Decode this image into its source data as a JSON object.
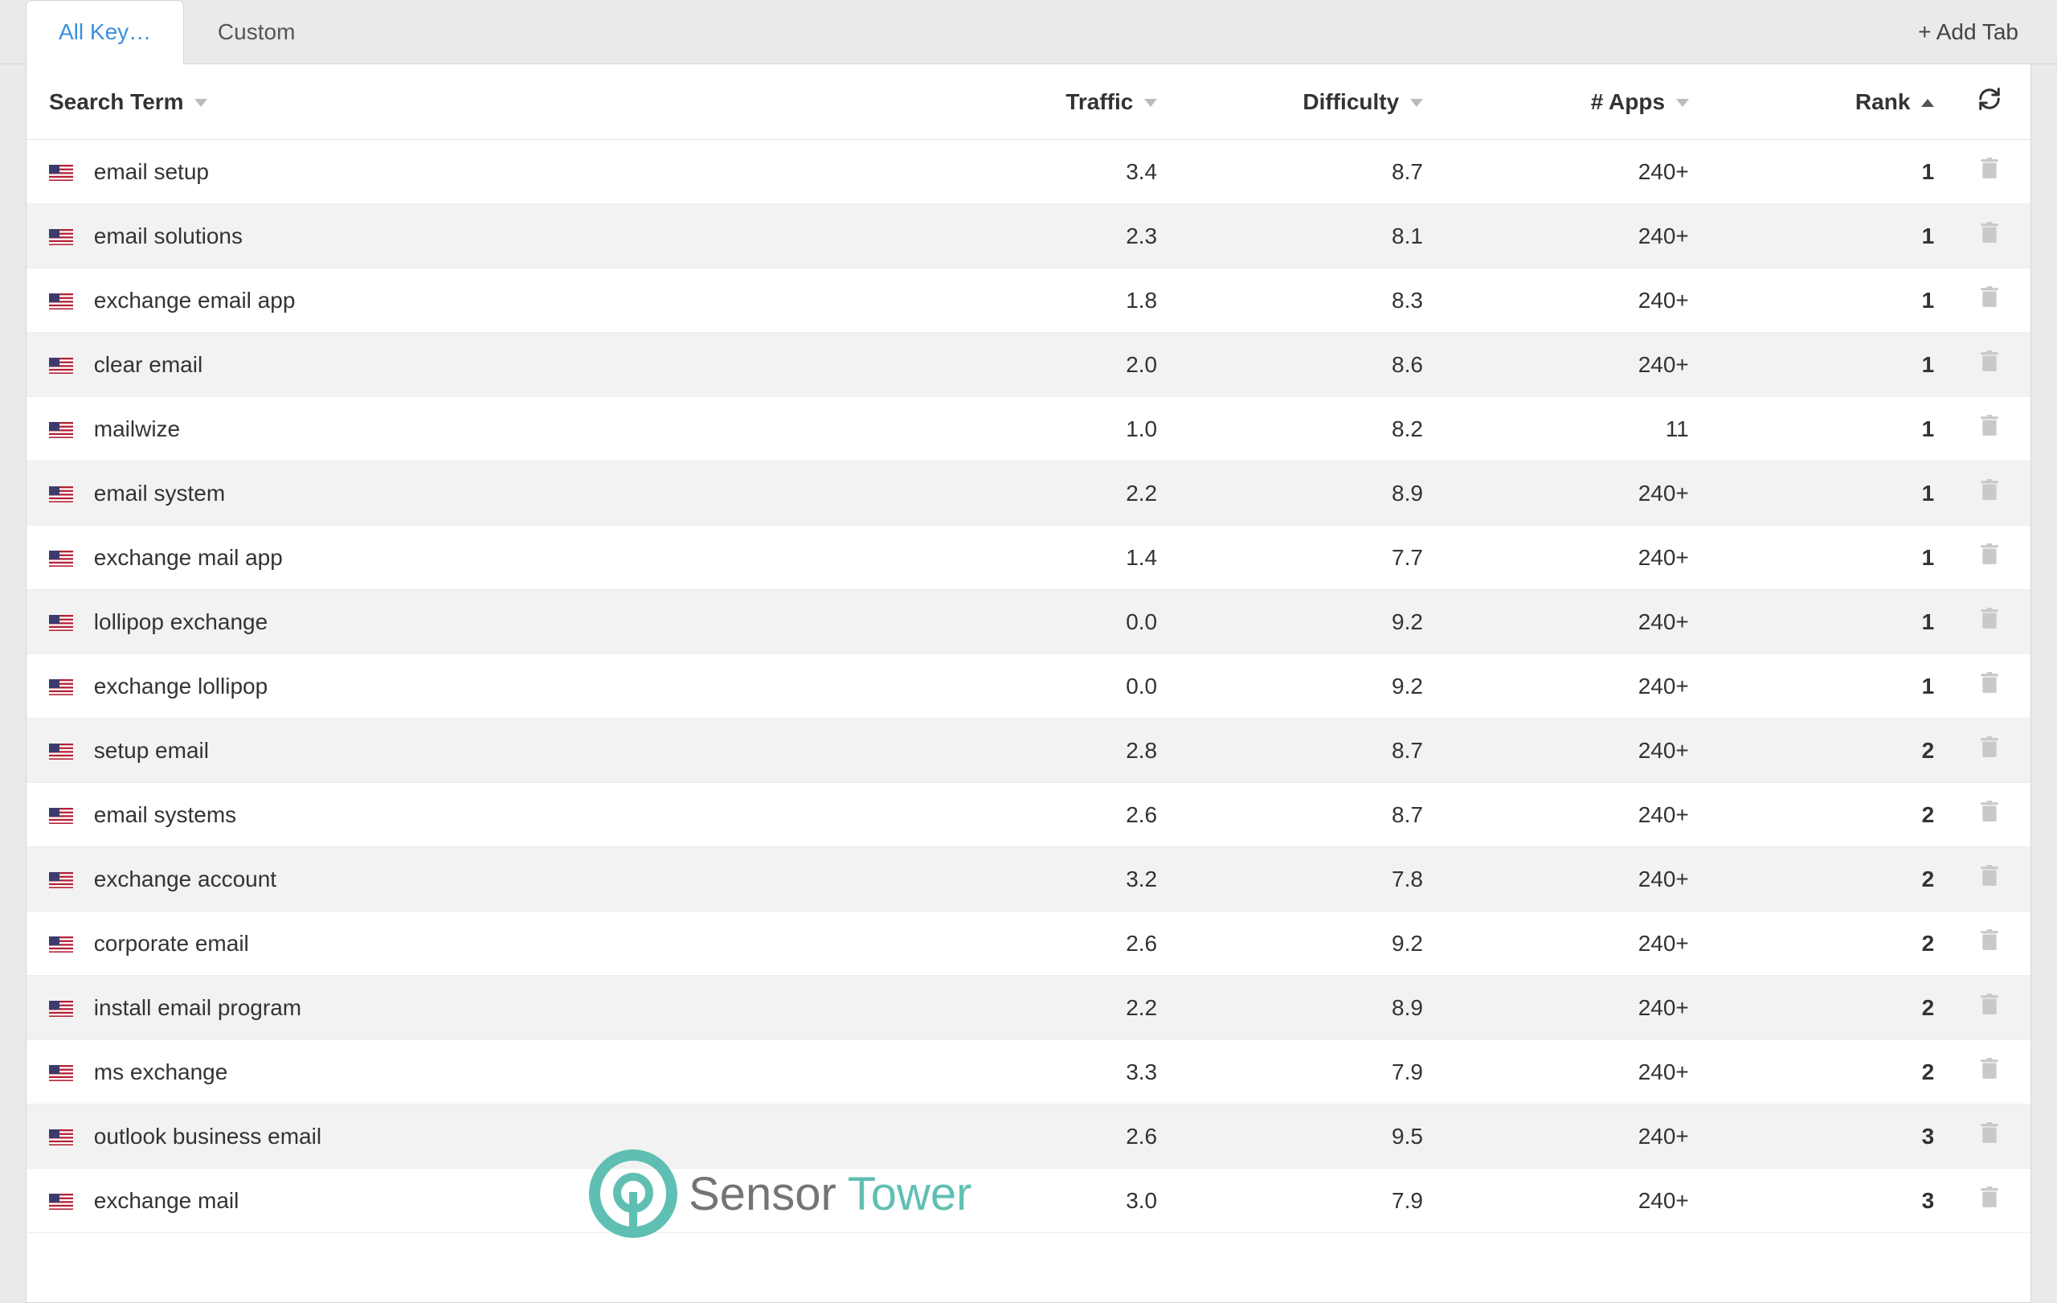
{
  "tabs": {
    "items": [
      {
        "label": "All Key…",
        "active": true
      },
      {
        "label": "Custom",
        "active": false
      }
    ],
    "add_label": "+ Add Tab"
  },
  "headers": {
    "search_term": "Search Term",
    "traffic": "Traffic",
    "difficulty": "Difficulty",
    "apps": "# Apps",
    "rank": "Rank"
  },
  "sort": {
    "column": "rank",
    "direction": "asc"
  },
  "rows": [
    {
      "term": "email setup",
      "traffic": "3.4",
      "difficulty": "8.7",
      "apps": "240+",
      "rank": "1"
    },
    {
      "term": "email solutions",
      "traffic": "2.3",
      "difficulty": "8.1",
      "apps": "240+",
      "rank": "1"
    },
    {
      "term": "exchange email app",
      "traffic": "1.8",
      "difficulty": "8.3",
      "apps": "240+",
      "rank": "1"
    },
    {
      "term": "clear email",
      "traffic": "2.0",
      "difficulty": "8.6",
      "apps": "240+",
      "rank": "1"
    },
    {
      "term": "mailwize",
      "traffic": "1.0",
      "difficulty": "8.2",
      "apps": "11",
      "rank": "1"
    },
    {
      "term": "email system",
      "traffic": "2.2",
      "difficulty": "8.9",
      "apps": "240+",
      "rank": "1"
    },
    {
      "term": "exchange mail app",
      "traffic": "1.4",
      "difficulty": "7.7",
      "apps": "240+",
      "rank": "1"
    },
    {
      "term": "lollipop exchange",
      "traffic": "0.0",
      "difficulty": "9.2",
      "apps": "240+",
      "rank": "1"
    },
    {
      "term": "exchange lollipop",
      "traffic": "0.0",
      "difficulty": "9.2",
      "apps": "240+",
      "rank": "1"
    },
    {
      "term": "setup email",
      "traffic": "2.8",
      "difficulty": "8.7",
      "apps": "240+",
      "rank": "2"
    },
    {
      "term": "email systems",
      "traffic": "2.6",
      "difficulty": "8.7",
      "apps": "240+",
      "rank": "2"
    },
    {
      "term": "exchange account",
      "traffic": "3.2",
      "difficulty": "7.8",
      "apps": "240+",
      "rank": "2"
    },
    {
      "term": "corporate email",
      "traffic": "2.6",
      "difficulty": "9.2",
      "apps": "240+",
      "rank": "2"
    },
    {
      "term": "install email program",
      "traffic": "2.2",
      "difficulty": "8.9",
      "apps": "240+",
      "rank": "2"
    },
    {
      "term": "ms exchange",
      "traffic": "3.3",
      "difficulty": "7.9",
      "apps": "240+",
      "rank": "2"
    },
    {
      "term": "outlook business email",
      "traffic": "2.6",
      "difficulty": "9.5",
      "apps": "240+",
      "rank": "3"
    },
    {
      "term": "exchange mail",
      "traffic": "3.0",
      "difficulty": "7.9",
      "apps": "240+",
      "rank": "3"
    }
  ],
  "watermark": {
    "t1": "Sensor",
    "t2": "Tower"
  },
  "locale_flag": "us"
}
